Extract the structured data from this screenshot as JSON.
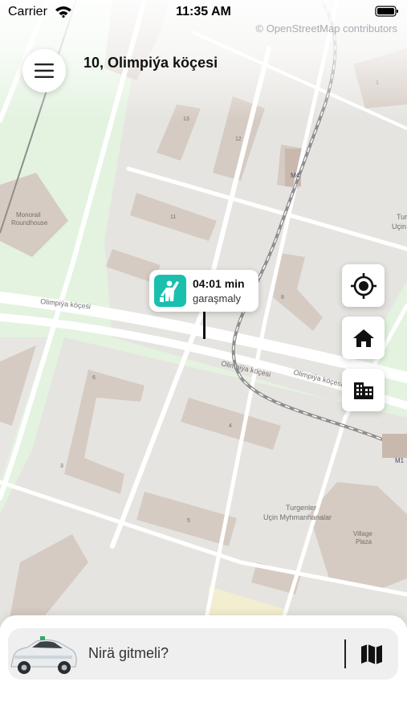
{
  "status_bar": {
    "carrier": "Carrier",
    "time": "11:35 AM"
  },
  "map": {
    "attribution": "© OpenStreetMap contributors",
    "labels": {
      "street_1": "Olimpiýa köçesi",
      "street_2": "Olimpiýa köçesi",
      "street_3": "Olimpiýa köçesi",
      "monorail_a": "Monorail",
      "monorail_b": "Roundhouse",
      "hotel_a": "Turgenler",
      "hotel_b": "Uçin Myhmanhanalar",
      "village_a": "Village",
      "village_b": "Plaza",
      "tur_a": "Tur",
      "tur_b": "Uçin",
      "m4": "M4",
      "m1": "M1",
      "b1": "1",
      "b11": "11",
      "b12": "12",
      "b13": "13",
      "b8": "8",
      "b6": "6",
      "b4": "4",
      "b3": "3",
      "b5": "5"
    }
  },
  "header": {
    "address": "10, Olimpiýa köçesi"
  },
  "pickup_pin": {
    "time": "04:01 min",
    "label": "garaşmaly"
  },
  "search": {
    "placeholder": "Nirä gitmeli?"
  },
  "colors": {
    "accent": "#1abfae",
    "park": "#e3f3e0",
    "building": "#d6cbc3",
    "block": "#e6e4e0",
    "rail": "#8e8e8e"
  },
  "icons": [
    "menu-icon",
    "locate-icon",
    "home-icon",
    "office-icon",
    "pickup-person-icon",
    "car-icon",
    "map-icon",
    "wifi-icon",
    "battery-icon"
  ]
}
